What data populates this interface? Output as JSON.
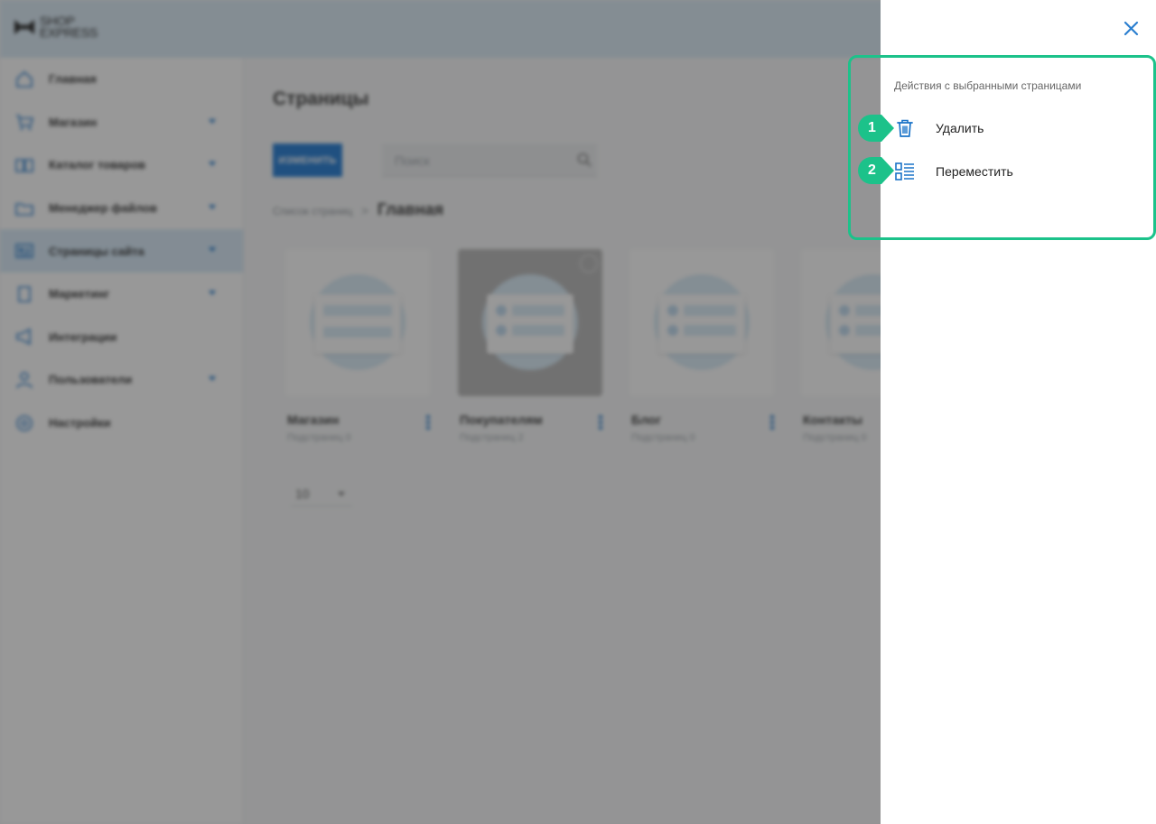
{
  "logo": {
    "line1": "SHOP",
    "line2": "EXPRESS"
  },
  "sidebar": {
    "items": [
      {
        "label": "Главная",
        "icon": "home-icon",
        "has_caret": false
      },
      {
        "label": "Магазин",
        "icon": "cart-icon",
        "has_caret": true
      },
      {
        "label": "Каталог товаров",
        "icon": "book-icon",
        "has_caret": true
      },
      {
        "label": "Менеджер файлов",
        "icon": "folder-icon",
        "has_caret": true
      },
      {
        "label": "Страницы сайта",
        "icon": "pages-icon",
        "has_caret": true,
        "active": true
      },
      {
        "label": "Маркетинг",
        "icon": "marketing-icon",
        "has_caret": true
      },
      {
        "label": "Интеграции",
        "icon": "megaphone-icon",
        "has_caret": false
      },
      {
        "label": "Пользователи",
        "icon": "users-icon",
        "has_caret": true
      },
      {
        "label": "Настройки",
        "icon": "gear-icon",
        "has_caret": false
      }
    ]
  },
  "main": {
    "title": "Страницы",
    "edit_button": "ИЗМЕНИТЬ",
    "search_placeholder": "Поиск",
    "breadcrumb": {
      "link": "Список страниц",
      "separator": ">",
      "current": "Главная"
    },
    "cards": [
      {
        "name": "Магазин",
        "sub": "Подстраниц 0",
        "selected": false
      },
      {
        "name": "Покупателям",
        "sub": "Подстраниц 2",
        "selected": true
      },
      {
        "name": "Блог",
        "sub": "Подстраниц 0",
        "selected": false
      },
      {
        "name": "Контакты",
        "sub": "Подстраниц 0",
        "selected": false
      }
    ],
    "page_size": "10"
  },
  "panel": {
    "heading": "Действия с выбранными страницами",
    "actions": [
      {
        "badge": "1",
        "label": "Удалить",
        "icon": "trash-icon"
      },
      {
        "badge": "2",
        "label": "Переместить",
        "icon": "move-list-icon"
      }
    ]
  },
  "colors": {
    "accent": "#1976d2",
    "highlight": "#1cc28a",
    "active_nav": "#d6e9f8"
  }
}
